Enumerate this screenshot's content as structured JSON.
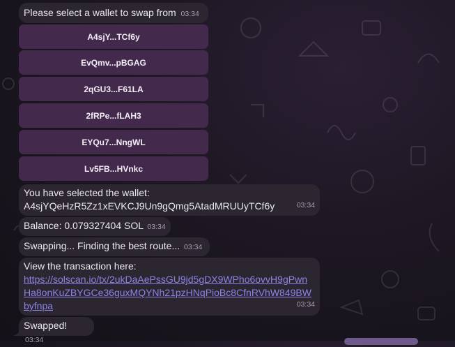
{
  "prompt": {
    "text": "Please select a wallet to swap from",
    "time": "03:34"
  },
  "wallets": [
    {
      "label": "A4sjY...TCf6y"
    },
    {
      "label": "EvQmv...pBGAG"
    },
    {
      "label": "2qGU3...F61LA"
    },
    {
      "label": "2fRPe...fLAH3"
    },
    {
      "label": "EYQu7...NngWL"
    },
    {
      "label": "Lv5FB...HVnkc"
    }
  ],
  "selected": {
    "line1": "You have selected the wallet:",
    "line2": "A4sjYQeHzR5Zz1xEVKCJ9Un9gQmg5AtadMRUUyTCf6y",
    "time": "03:34"
  },
  "balance": {
    "text": "Balance: 0.079327404 SOL",
    "time": "03:34"
  },
  "swapping": {
    "text": "Swapping... Finding the best route...",
    "time": "03:34"
  },
  "transaction": {
    "intro": "View the transaction here:",
    "link": "https://solscan.io/tx/2ukDaAePssGU9jd5gDX9WPho6ovvH9gPwnHa8onKuZBYGCe36guxMQYNh21pzHNqPioBc8CfnRVhW849BWbyfnpa",
    "time": "03:34"
  },
  "swapped": {
    "text": "Swapped!",
    "time": "03:34"
  },
  "colors": {
    "bubble": "#2b2630",
    "button": "#432a4d",
    "link": "#8e84e6",
    "accent": "#6f5a8c"
  }
}
